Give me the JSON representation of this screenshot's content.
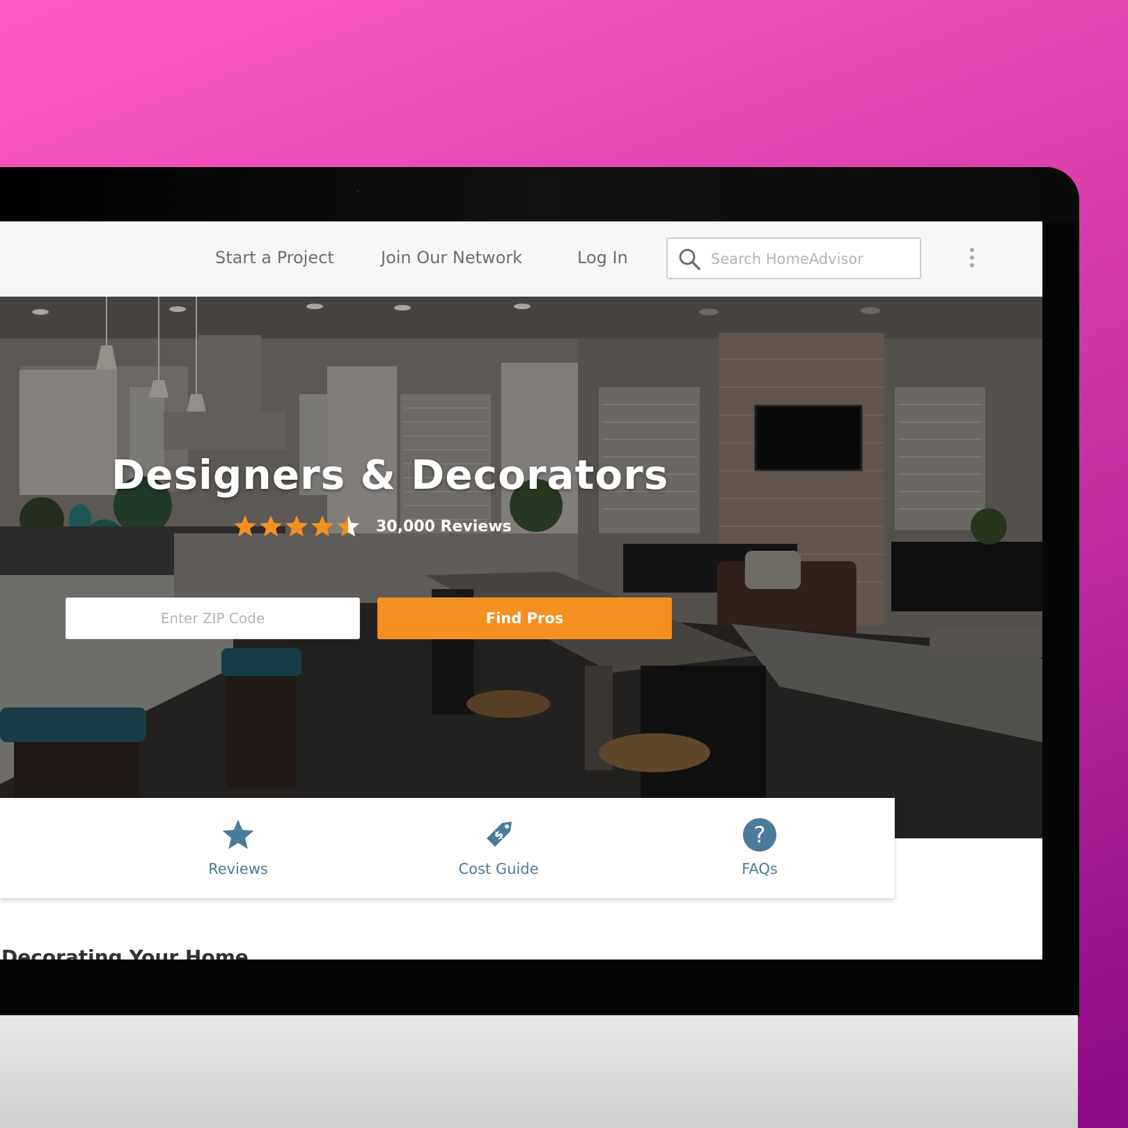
{
  "nav": {
    "start_project": "Start a Project",
    "join_network": "Join Our Network",
    "log_in": "Log In",
    "search_placeholder": "Search HomeAdvisor"
  },
  "hero": {
    "title": "Designers & Decorators",
    "rating": 4.5,
    "rating_max": 5,
    "reviews": "30,000 Reviews",
    "zip_placeholder": "Enter ZIP Code",
    "find_button": "Find Pros"
  },
  "tabs": [
    {
      "label": "Reviews",
      "icon": "star-icon"
    },
    {
      "label": "Cost Guide",
      "icon": "price-tag-icon"
    },
    {
      "label": "FAQs",
      "icon": "question-icon"
    }
  ],
  "section_heading": "Decorating Your Home",
  "colors": {
    "accent_orange": "#f48f22",
    "tab_blue": "#4a7b98",
    "background_pink": "#ff5ac1",
    "background_purple": "#8a0a86"
  }
}
